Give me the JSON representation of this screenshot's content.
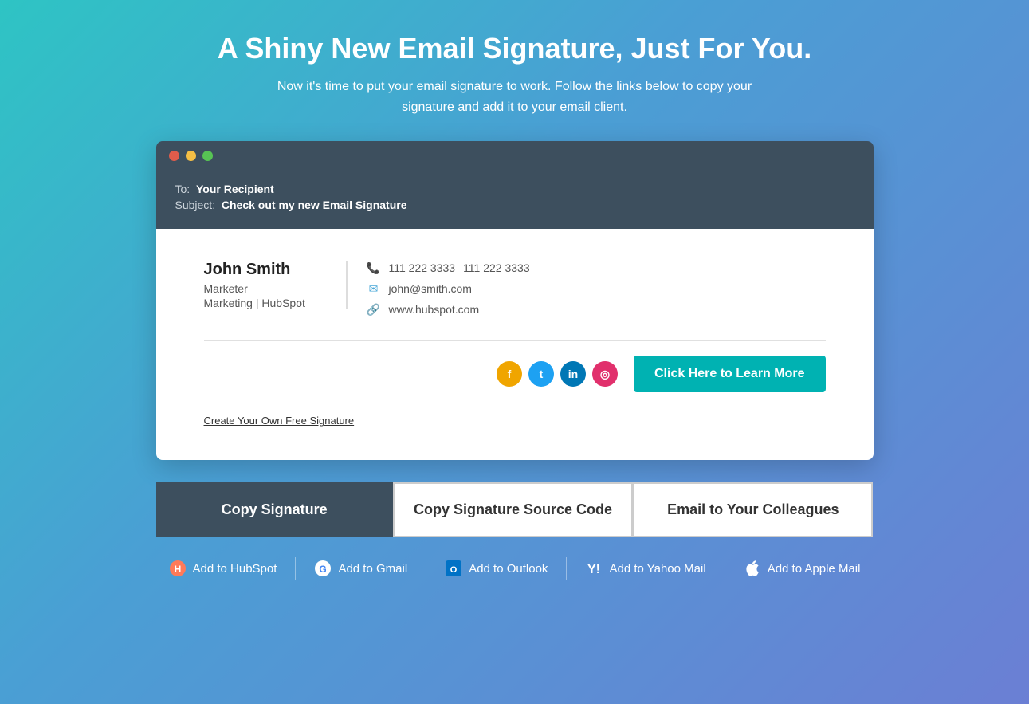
{
  "page": {
    "title": "A Shiny New Email Signature, Just For You.",
    "subtitle": "Now it's time to put your email signature to work. Follow the links below to copy your signature and add it to your email client."
  },
  "email_preview": {
    "titlebar_dots": [
      "red",
      "yellow",
      "green"
    ],
    "to_label": "To:",
    "to_value": "Your Recipient",
    "subject_label": "Subject:",
    "subject_value": "Check out my new Email Signature"
  },
  "signature": {
    "name": "John Smith",
    "title": "Marketer",
    "company": "Marketing | HubSpot",
    "phone1": "111 222 3333",
    "phone2": "111 222 3333",
    "email": "john@smith.com",
    "website": "www.hubspot.com",
    "cta_button": "Click Here to Learn More",
    "create_link": "Create Your Own Free Signature"
  },
  "social_icons": [
    {
      "name": "facebook",
      "symbol": "f"
    },
    {
      "name": "twitter",
      "symbol": "t"
    },
    {
      "name": "linkedin",
      "symbol": "in"
    },
    {
      "name": "instagram",
      "symbol": "◎"
    }
  ],
  "action_buttons": [
    {
      "id": "copy-signature",
      "label": "Copy Signature",
      "style": "dark"
    },
    {
      "id": "copy-source",
      "label": "Copy Signature Source Code",
      "style": "light"
    },
    {
      "id": "email-colleagues",
      "label": "Email to Your Colleagues",
      "style": "light"
    }
  ],
  "add_to_items": [
    {
      "id": "hubspot",
      "label": "Add to HubSpot",
      "icon": "hubspot"
    },
    {
      "id": "gmail",
      "label": "Add to Gmail",
      "icon": "google"
    },
    {
      "id": "outlook",
      "label": "Add to Outlook",
      "icon": "outlook"
    },
    {
      "id": "yahoo",
      "label": "Add to Yahoo Mail",
      "icon": "yahoo"
    },
    {
      "id": "apple",
      "label": "Add to Apple Mail",
      "icon": "apple"
    }
  ]
}
